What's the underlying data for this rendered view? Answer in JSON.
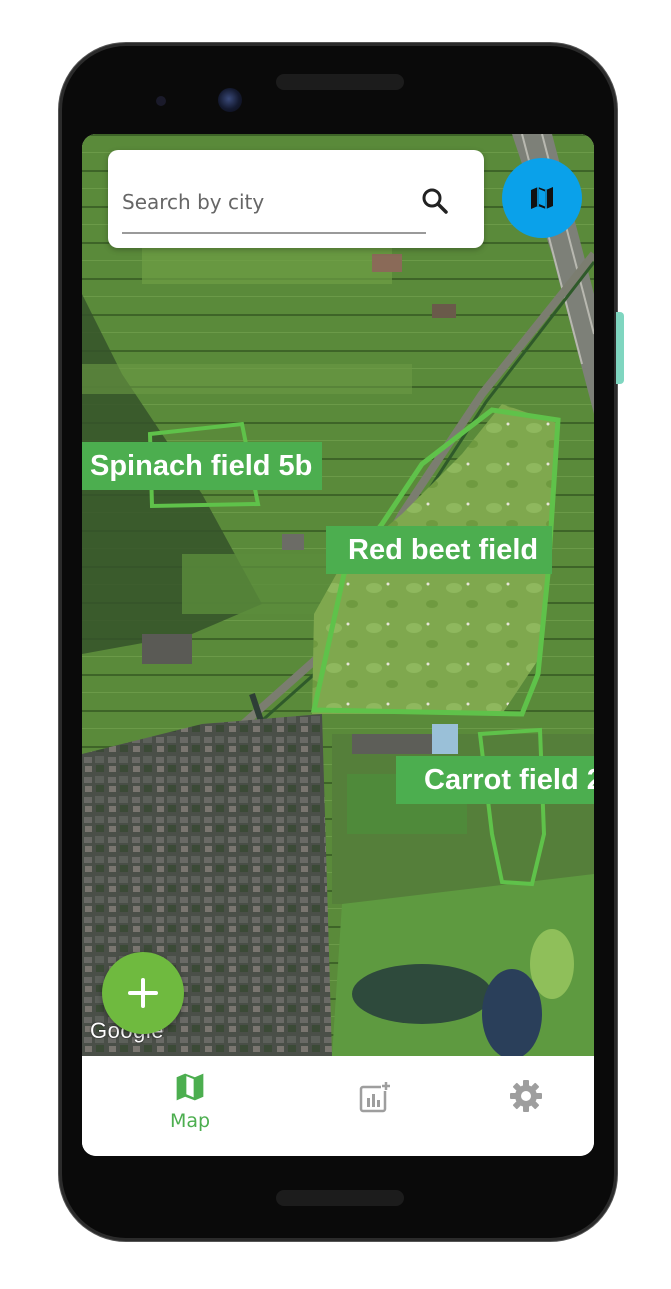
{
  "search": {
    "placeholder": "Search by city",
    "icon": "search-icon"
  },
  "map_type_button": {
    "icon": "map-icon",
    "color": "#0aa1ea"
  },
  "fields": [
    {
      "label": "Spinach field 5b"
    },
    {
      "label": "Red beet field"
    },
    {
      "label": "Carrot field 2"
    }
  ],
  "map_attribution": "Google",
  "add_button": {
    "icon": "plus-icon",
    "color": "#6fba3f"
  },
  "bottom_nav": {
    "items": [
      {
        "label": "Map",
        "icon": "map-icon",
        "active": true
      },
      {
        "label": "",
        "icon": "chart-add-icon",
        "active": false
      },
      {
        "label": "",
        "icon": "gear-icon",
        "active": false
      }
    ]
  },
  "colors": {
    "accent": "#4cae4f",
    "field_outline": "#5fc24a",
    "inactive_icon": "#9e9e9e"
  }
}
